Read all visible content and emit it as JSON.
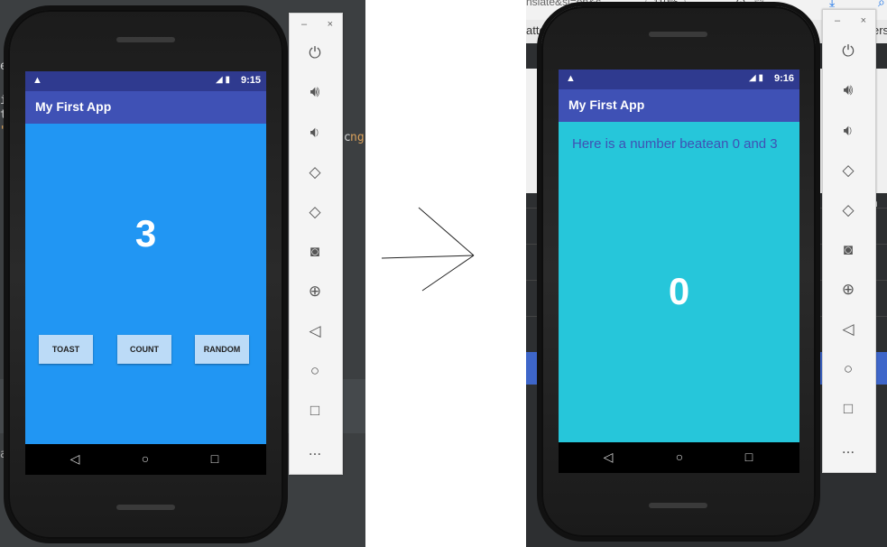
{
  "left_ide": {
    "tab_text": "ec",
    "code_lines": [
      "ir",
      "t\"",
      "\">"
    ],
    "right_fragment": ".c",
    "right_fragment2": "ng",
    "bottom_text": "av"
  },
  "right_browser": {
    "url_fragment": "nslate&sl=en&c",
    "zoom": "110%",
    "menu_dots": "···",
    "tab_fragment": "atte",
    "tab_fragment_right": "ers",
    "row_fragments": [
      "1,",
      "3,",
      "3,",
      "2,",
      "2,"
    ],
    "col_fragment": "n"
  },
  "left_phone": {
    "status_time": "9:15",
    "app_title": "My First App",
    "number": "3",
    "buttons": [
      "TOAST",
      "COUNT",
      "RANDOM"
    ],
    "colors": {
      "content": "#2196f3",
      "appbar": "#3f51b5",
      "statusbar": "#2f3a8f",
      "button": "#bcdbf7"
    }
  },
  "right_phone": {
    "status_time": "9:16",
    "app_title": "My First App",
    "message": "Here is a number beatean 0 and 3",
    "number": "0",
    "colors": {
      "content": "#26c6da",
      "message_text": "#3f51b5"
    }
  },
  "emulator_panel": {
    "minimize": "–",
    "close": "×",
    "icons": [
      "power-icon",
      "volume-up-icon",
      "volume-down-icon",
      "rotate-left-icon",
      "rotate-right-icon",
      "camera-icon",
      "zoom-icon",
      "back-icon",
      "home-icon",
      "overview-icon",
      "more-icon"
    ],
    "more_label": "..."
  }
}
